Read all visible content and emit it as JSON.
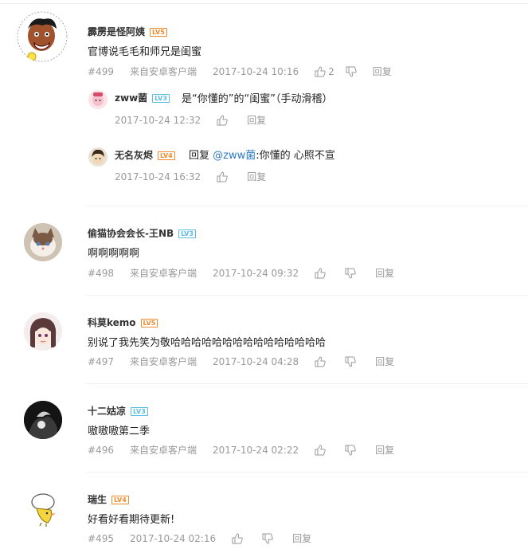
{
  "colors": {
    "accent_link": "#2e7ac6",
    "level_orange": "#f08a2c",
    "level_blue": "#5bbbe0",
    "meta_gray": "#9a9a9a"
  },
  "comments": [
    {
      "user": "霹雳是怪阿姨",
      "level": "LV5",
      "text": "官博说毛毛和师兄是闺蜜",
      "floor": "#499",
      "source": "来自安卓客户端",
      "time": "2017-10-24 10:16",
      "likes": "2",
      "reply_label": "回复",
      "avatar_icon": "cartoon-warrior-avatar",
      "replies": [
        {
          "user": "zww菌",
          "level": "LV3",
          "text": "是“你懂的”的“闺蜜”（手动滑稽）",
          "time": "2017-10-24 12:32",
          "reply_label": "回复",
          "avatar_icon": "pink-cartoon-avatar"
        },
        {
          "user": "无名灰烬",
          "level": "LV4",
          "reply_prefix": "回复",
          "mention": "@zww菌",
          "text": ":你懂的 心照不宣",
          "time": "2017-10-24 16:32",
          "reply_label": "回复",
          "avatar_icon": "dark-hair-avatar"
        }
      ]
    },
    {
      "user": "偷猫协会会长-王NB",
      "level": "LV3",
      "text": "啊啊啊啊啊",
      "floor": "#498",
      "source": "来自安卓客户端",
      "time": "2017-10-24 09:32",
      "reply_label": "回复",
      "avatar_icon": "cat-avatar"
    },
    {
      "user": "科莫kemo",
      "level": "LV5",
      "text": "别说了我先笑为敬哈哈哈哈哈哈哈哈哈哈哈哈哈哈哈",
      "floor": "#497",
      "source": "来自安卓客户端",
      "time": "2017-10-24 04:28",
      "reply_label": "回复",
      "avatar_icon": "anime-girl-avatar"
    },
    {
      "user": "十二姑凉",
      "level": "LV3",
      "text": "嗷嗷嗷第二季",
      "floor": "#496",
      "source": "来自安卓客户端",
      "time": "2017-10-24 02:22",
      "reply_label": "回复",
      "avatar_icon": "dark-photo-avatar"
    },
    {
      "user": "瑞生",
      "level": "LV4",
      "text": "好看好看期待更新!",
      "floor": "#495",
      "time": "2017-10-24 02:16",
      "reply_label": "回复",
      "avatar_icon": "cartoon-chick-avatar"
    }
  ]
}
